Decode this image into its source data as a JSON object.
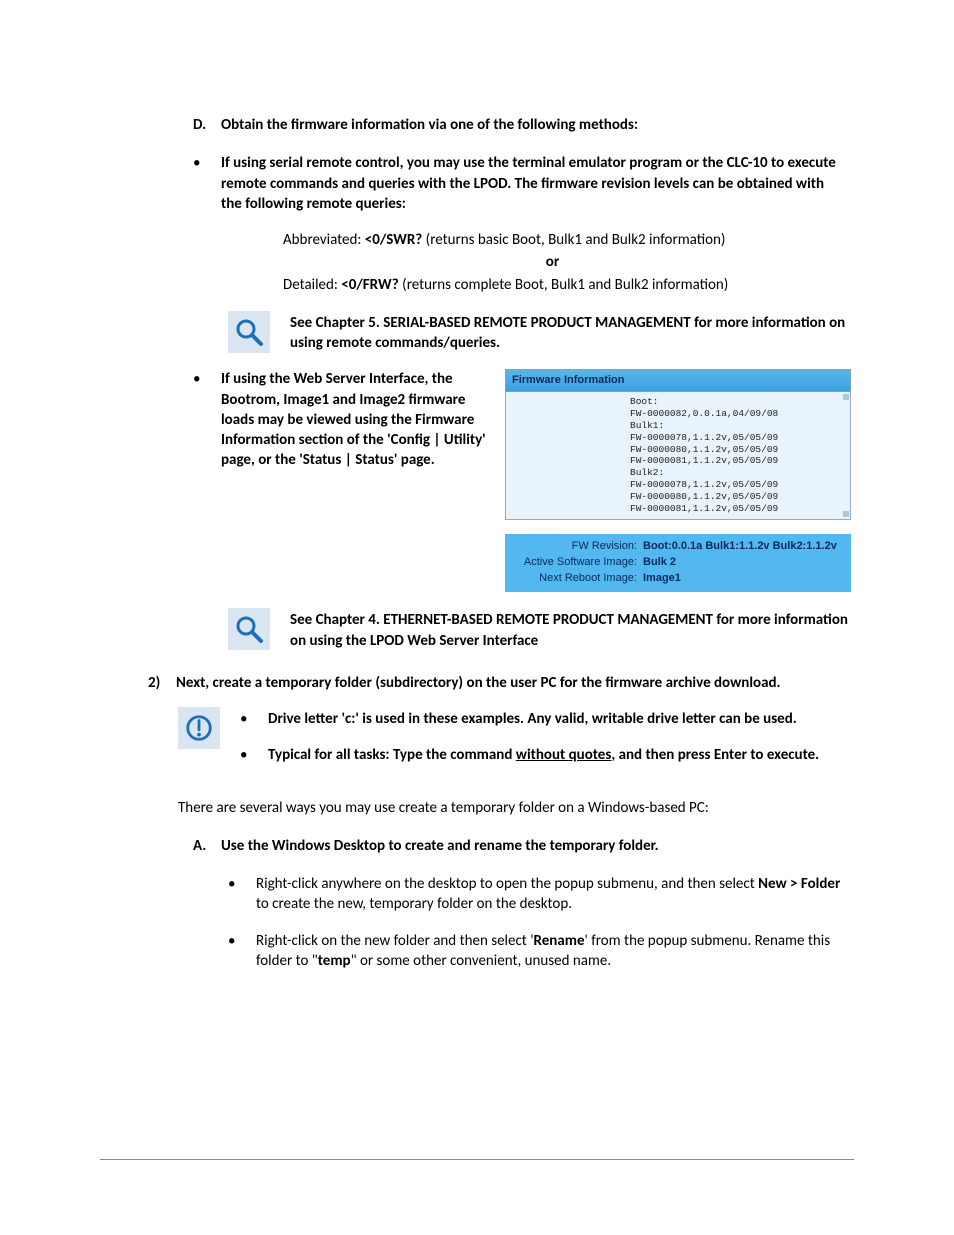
{
  "sectionD": {
    "marker": "D.",
    "title": "Obtain the firmware information via one of the following methods:",
    "bullets": [
      {
        "text": "If using serial remote control, you may use the terminal emulator program or the CLC-10 to execute remote commands and queries with the LPOD. The firmware revision levels can be obtained with the following remote queries:"
      }
    ],
    "queries": {
      "abbr_label": "Abbreviated: ",
      "abbr_cmd": "<0/SWR?",
      "abbr_rest": " (returns basic Boot, Bulk1 and Bulk2 information)",
      "or": "or",
      "det_label": "Detailed: ",
      "det_cmd": "<0/FRW?",
      "det_rest": " (returns complete Boot, Bulk1 and Bulk2 information)"
    },
    "note5": "See Chapter 5. SERIAL-BASED REMOTE PRODUCT MANAGEMENT for more information on using remote commands/queries.",
    "web_bullet": "If using the Web Server Interface, the Bootrom, Image1 and Image2 firmware loads may be viewed using the Firmware Information section of the 'Config | Utility' page, or the 'Status | Status' page.",
    "note4": "See Chapter 4. ETHERNET-BASED REMOTE PRODUCT MANAGEMENT for more information on using the LPOD Web Server Interface"
  },
  "firmware_panel": {
    "title": "Firmware Information",
    "lines": [
      "Boot:",
      "FW-0000082,0.0.1a,04/09/08",
      "Bulk1:",
      "FW-0000078,1.1.2v,05/05/09",
      "FW-0000080,1.1.2v,05/05/09",
      "FW-0000081,1.1.2v,05/05/09",
      "Bulk2:",
      "FW-0000078,1.1.2v,05/05/09",
      "FW-0000080,1.1.2v,05/05/09",
      "FW-0000081,1.1.2v,05/05/09"
    ],
    "rev_label": "FW Revision:",
    "rev_value": "Boot:0.0.1a Bulk1:1.1.2v Bulk2:1.1.2v",
    "active_label": "Active Software Image:",
    "active_value": "Bulk 2",
    "next_label": "Next Reboot Image:",
    "next_value": "Image1"
  },
  "step2": {
    "marker": "2)",
    "text": "Next, create a temporary folder (subdirectory) on the user PC for the firmware archive download.",
    "notes": [
      {
        "pre": "Drive letter 'c:' is used in these examples. Any valid, writable drive letter can be used."
      },
      {
        "pre": "Typical for all tasks: Type the command ",
        "u": "without quotes",
        "post": ", and then press Enter to execute."
      }
    ],
    "several_ways": "There are several ways you may use create a temporary folder on a Windows-based PC:"
  },
  "sectionA2": {
    "marker": "A.",
    "title": "Use the Windows Desktop to create and rename the temporary folder.",
    "bullets": [
      {
        "pre": "Right-click anywhere on the desktop to open the popup submenu, and then select ",
        "b": "New > Folder",
        "post": " to create the new, temporary folder on the desktop."
      },
      {
        "pre": "Right-click on the new folder and then select '",
        "b": "Rename",
        "post": "' from the popup submenu. Rename this folder to \"",
        "b2": "temp",
        "post2": "\" or some other convenient, unused name."
      }
    ]
  }
}
